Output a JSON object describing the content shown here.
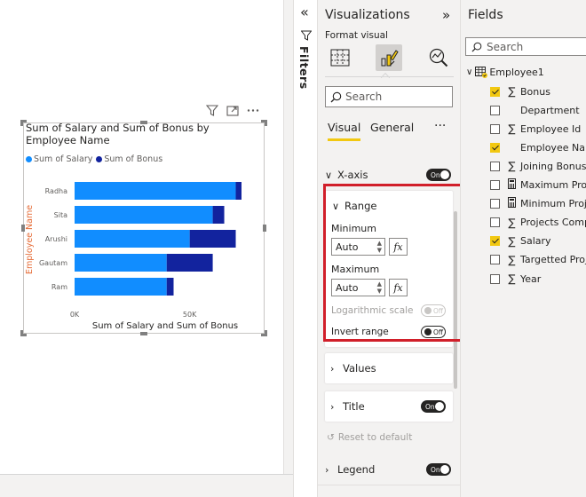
{
  "visual": {
    "header_icons": [
      "filter-icon",
      "focus-mode-icon",
      "more-options-icon"
    ],
    "title": "Sum of Salary and Sum of Bonus by Employee Name",
    "legend": [
      {
        "name": "Sum of Salary",
        "color": "#118dff"
      },
      {
        "name": "Sum of Bonus",
        "color": "#12239e"
      }
    ]
  },
  "chart_data": {
    "type": "bar",
    "orientation": "horizontal",
    "stacked": true,
    "title": "Sum of Salary and Sum of Bonus by Employee Name",
    "categories": [
      "Radha",
      "Sita",
      "Arushi",
      "Gautam",
      "Ram"
    ],
    "series": [
      {
        "name": "Sum of Salary",
        "color": "#118dff",
        "values": [
          70000,
          60000,
          50000,
          40000,
          40000
        ]
      },
      {
        "name": "Sum of Bonus",
        "color": "#12239e",
        "values": [
          2500,
          5000,
          20000,
          20000,
          3000
        ]
      }
    ],
    "xlabel": "Sum of Salary and Sum of Bonus",
    "ylabel": "Employee Name",
    "xlim": [
      0,
      72500
    ],
    "xticks": [
      "0K",
      "50K"
    ],
    "xtick_values": [
      0,
      50000
    ],
    "legend_position": "top-left",
    "grid": false
  },
  "filters": {
    "label": "Filters"
  },
  "viz_pane": {
    "title": "Visualizations",
    "subtitle": "Format visual",
    "search_placeholder": "Search",
    "tabs": [
      {
        "label": "Visual",
        "active": true
      },
      {
        "label": "General",
        "active": false
      }
    ],
    "xaxis": {
      "label": "X-axis",
      "toggle": "On"
    },
    "range": {
      "label": "Range",
      "minimum_label": "Minimum",
      "minimum_value": "Auto",
      "maximum_label": "Maximum",
      "maximum_value": "Auto",
      "fx_label": "fx",
      "log_scale_label": "Logarithmic scale",
      "log_scale_toggle": "Off",
      "invert_label": "Invert range",
      "invert_toggle": "Off"
    },
    "values_section": {
      "label": "Values"
    },
    "title_section": {
      "label": "Title",
      "toggle": "On"
    },
    "reset_label": "Reset to default",
    "legend_section": {
      "label": "Legend",
      "toggle": "On"
    }
  },
  "fields_pane": {
    "title": "Fields",
    "search_placeholder": "Search",
    "table_name": "Employee1",
    "fields": [
      {
        "name": "Bonus",
        "checked": true,
        "icon": "sigma"
      },
      {
        "name": "Department",
        "checked": false,
        "icon": "none"
      },
      {
        "name": "Employee Id",
        "checked": false,
        "icon": "sigma"
      },
      {
        "name": "Employee Name",
        "checked": true,
        "icon": "none"
      },
      {
        "name": "Joining Bonus",
        "checked": false,
        "icon": "sigma"
      },
      {
        "name": "Maximum Project",
        "checked": false,
        "icon": "calculator"
      },
      {
        "name": "Minimum Project",
        "checked": false,
        "icon": "calculator"
      },
      {
        "name": "Projects Complete",
        "checked": false,
        "icon": "sigma"
      },
      {
        "name": "Salary",
        "checked": true,
        "icon": "sigma"
      },
      {
        "name": "Targetted Project",
        "checked": false,
        "icon": "sigma"
      },
      {
        "name": "Year",
        "checked": false,
        "icon": "sigma"
      }
    ]
  }
}
